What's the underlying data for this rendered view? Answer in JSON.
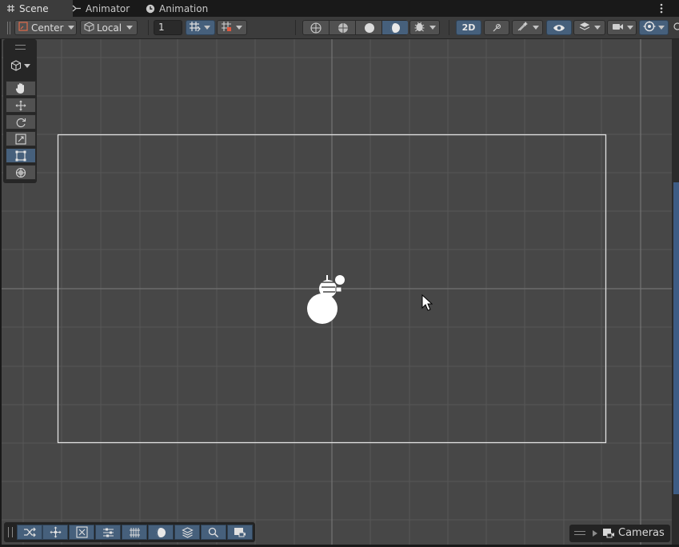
{
  "tabs": [
    {
      "label": "Scene",
      "icon": "hash-icon"
    },
    {
      "label": "Animator",
      "icon": "animator-icon"
    },
    {
      "label": "Animation",
      "icon": "clock-icon"
    }
  ],
  "toolbar": {
    "pivot_mode": "Center",
    "pivot_rotation": "Local",
    "grid_snap_value": "1",
    "mode_2d_label": "2D"
  },
  "tool_palette": {
    "tools": [
      "hand-tool",
      "move-tool",
      "rotate-tool",
      "scale-tool",
      "rect-tool",
      "transform-tool"
    ],
    "active_tool": "rect-tool"
  },
  "overlay_toolbar": {
    "buttons": [
      "shuffle-icon",
      "move-gizmo-icon",
      "constraint-icon",
      "settings-sliders-icon",
      "grid-lines-icon",
      "shading-icon",
      "layers-icon",
      "search-icon",
      "camera-preview-icon"
    ]
  },
  "cameras_overlay": {
    "label": "Cameras"
  },
  "colors": {
    "scene_bg": "#474747",
    "accent_blue": "#46607c",
    "toolbar_bg": "#3c3c3c"
  }
}
